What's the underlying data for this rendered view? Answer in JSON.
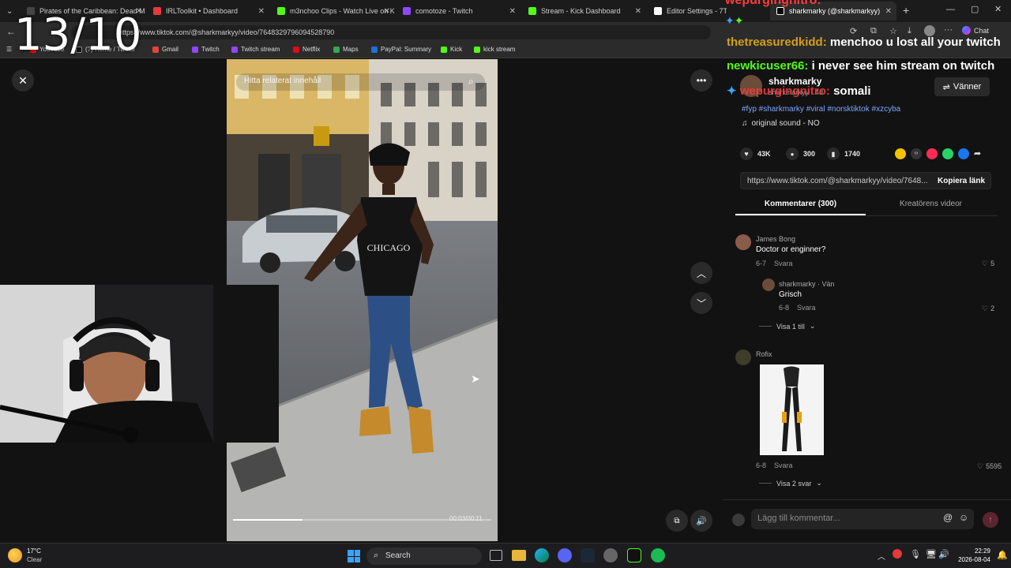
{
  "overlay": {
    "counter": "13/10"
  },
  "tabs": [
    {
      "label": "Pirates of the Caribbean: Dead M",
      "color": "#444"
    },
    {
      "label": "IRLToolkit • Dashboard",
      "color": "#e43a3a"
    },
    {
      "label": "m3nchoo Clips - Watch Live on Ki",
      "color": "#53fc18"
    },
    {
      "label": "comotoze - Twitch",
      "color": "#9146ff"
    },
    {
      "label": "Stream - Kick Dashboard",
      "color": "#53fc18"
    },
    {
      "label": "Editor Settings - 7TV",
      "color": "#ffffff"
    },
    {
      "label": "sharkmarky (@sharkmarkyy)",
      "color": "#ffffff"
    }
  ],
  "address": {
    "url": "https://www.tiktok.com/@sharkmarkyy/video/7648329796094528790"
  },
  "bookmarks": [
    {
      "label": "YouTube",
      "color": "#ff0000"
    },
    {
      "label": "(?) Home / Twitter",
      "color": "#111"
    },
    {
      "label": "Gmail",
      "color": "#ea4335"
    },
    {
      "label": "Twitch",
      "color": "#9146ff"
    },
    {
      "label": "Twitch stream",
      "color": "#9146ff"
    },
    {
      "label": "Netflix",
      "color": "#e50914"
    },
    {
      "label": "Maps",
      "color": "#34a853"
    },
    {
      "label": "PayPal: Summary",
      "color": "#1e6fd9"
    },
    {
      "label": "Kick",
      "color": "#53fc18"
    },
    {
      "label": "kick stream",
      "color": "#53fc18"
    }
  ],
  "browser": {
    "chat_label": "Chat"
  },
  "video": {
    "search_placeholder": "Hitta relaterat innehåll",
    "time": "00:03/00:11"
  },
  "post": {
    "username": "sharkmarky",
    "handle": "sharkmarkyy · 4d",
    "follow_label": "Vänner",
    "hashtags": "#fyp #sharkmarky #viral #norsktiktok #xzcyba",
    "sound": "original sound - NO",
    "likes": "43K",
    "comments": "300",
    "saves": "1740",
    "link": "https://www.tiktok.com/@sharkmarkyy/video/7648...",
    "copy_label": "Kopiera länk"
  },
  "tabs_panel": {
    "comments_tab": "Kommentarer (300)",
    "creator_tab": "Kreatörens videor"
  },
  "comments": [
    {
      "user": "James Bong",
      "text": "Doctor or enginner?",
      "date": "6-7",
      "reply": "Svara",
      "likes": "5"
    },
    {
      "user": "sharkmarky · Vän",
      "text": "Grisch",
      "date": "6-8",
      "reply": "Svara",
      "likes": "2"
    },
    {
      "user": "Rofix",
      "text": "",
      "date": "6-8",
      "reply": "Svara",
      "likes": "5595"
    }
  ],
  "more_replies": [
    "Visa 1 till",
    "Visa 2 svar"
  ],
  "comment_input": {
    "placeholder": "Lägg till kommentar..."
  },
  "chat_messages": [
    {
      "user": "wepurgingnitro:",
      "text": "",
      "user_color": "#ff3b3b"
    },
    {
      "user": "thetreasuredkidd:",
      "text": "menchoo u lost all your twitch",
      "user_color": "#d4a017"
    },
    {
      "user": "newkicuser66:",
      "text": "i never see him stream on twitch",
      "user_color": "#53fc18"
    },
    {
      "user": "wepurgingnitro:",
      "text": "somali",
      "user_color": "#ff3b3b"
    }
  ],
  "taskbar": {
    "weather_temp": "17°C",
    "weather_desc": "Clear",
    "search": "Search",
    "time": "22:29",
    "date": "2026-08-04"
  }
}
